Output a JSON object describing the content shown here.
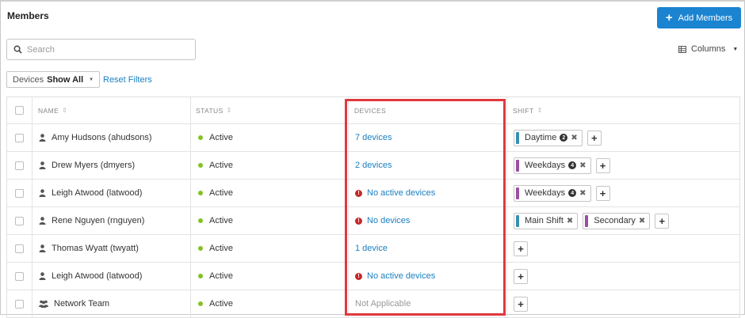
{
  "header": {
    "title": "Members",
    "add_button_label": "Add Members"
  },
  "search": {
    "placeholder": "Search"
  },
  "columns_label": "Columns",
  "filter": {
    "label": "Devices",
    "value": "Show All",
    "reset_label": "Reset Filters"
  },
  "table": {
    "headers": {
      "name": "NAME",
      "status": "STATUS",
      "devices": "DEVICES",
      "shift": "SHIFT"
    },
    "rows": [
      {
        "icon": "user-icon",
        "name": "Amy Hudsons (ahudsons)",
        "status": "Active",
        "devices": "7 devices",
        "devices_type": "link",
        "shifts": [
          {
            "label": "Daytime",
            "color": "#3a8fb0",
            "badge": "2"
          }
        ]
      },
      {
        "icon": "user-icon",
        "name": "Drew Myers (dmyers)",
        "status": "Active",
        "devices": "2 devices",
        "devices_type": "link",
        "shifts": [
          {
            "label": "Weekdays",
            "color": "#9b4fa0",
            "badge": "4"
          }
        ]
      },
      {
        "icon": "user-icon",
        "name": "Leigh Atwood (latwood)",
        "status": "Active",
        "devices": "No active devices",
        "devices_type": "warning",
        "shifts": [
          {
            "label": "Weekdays",
            "color": "#9b4fa0",
            "badge": "4"
          }
        ]
      },
      {
        "icon": "user-icon",
        "name": "Rene Nguyen (rnguyen)",
        "status": "Active",
        "devices": "No devices",
        "devices_type": "warning",
        "shifts": [
          {
            "label": "Main Shift",
            "color": "#3a8fb0",
            "badge": ""
          },
          {
            "label": "Secondary",
            "color": "#9b4fa0",
            "badge": ""
          }
        ]
      },
      {
        "icon": "user-icon",
        "name": "Thomas Wyatt (twyatt)",
        "status": "Active",
        "devices": "1 device",
        "devices_type": "link",
        "shifts": []
      },
      {
        "icon": "user-icon",
        "name": "Leigh Atwood (latwood)",
        "status": "Active",
        "devices": "No active devices",
        "devices_type": "warning",
        "shifts": []
      },
      {
        "icon": "team-icon",
        "name": "Network Team",
        "status": "Active",
        "devices": "Not Applicable",
        "devices_type": "muted",
        "shifts": []
      }
    ]
  },
  "colors": {
    "accent": "#1a84d1",
    "active": "#84c225",
    "warning": "#c62828",
    "highlight": "#e0393e"
  }
}
